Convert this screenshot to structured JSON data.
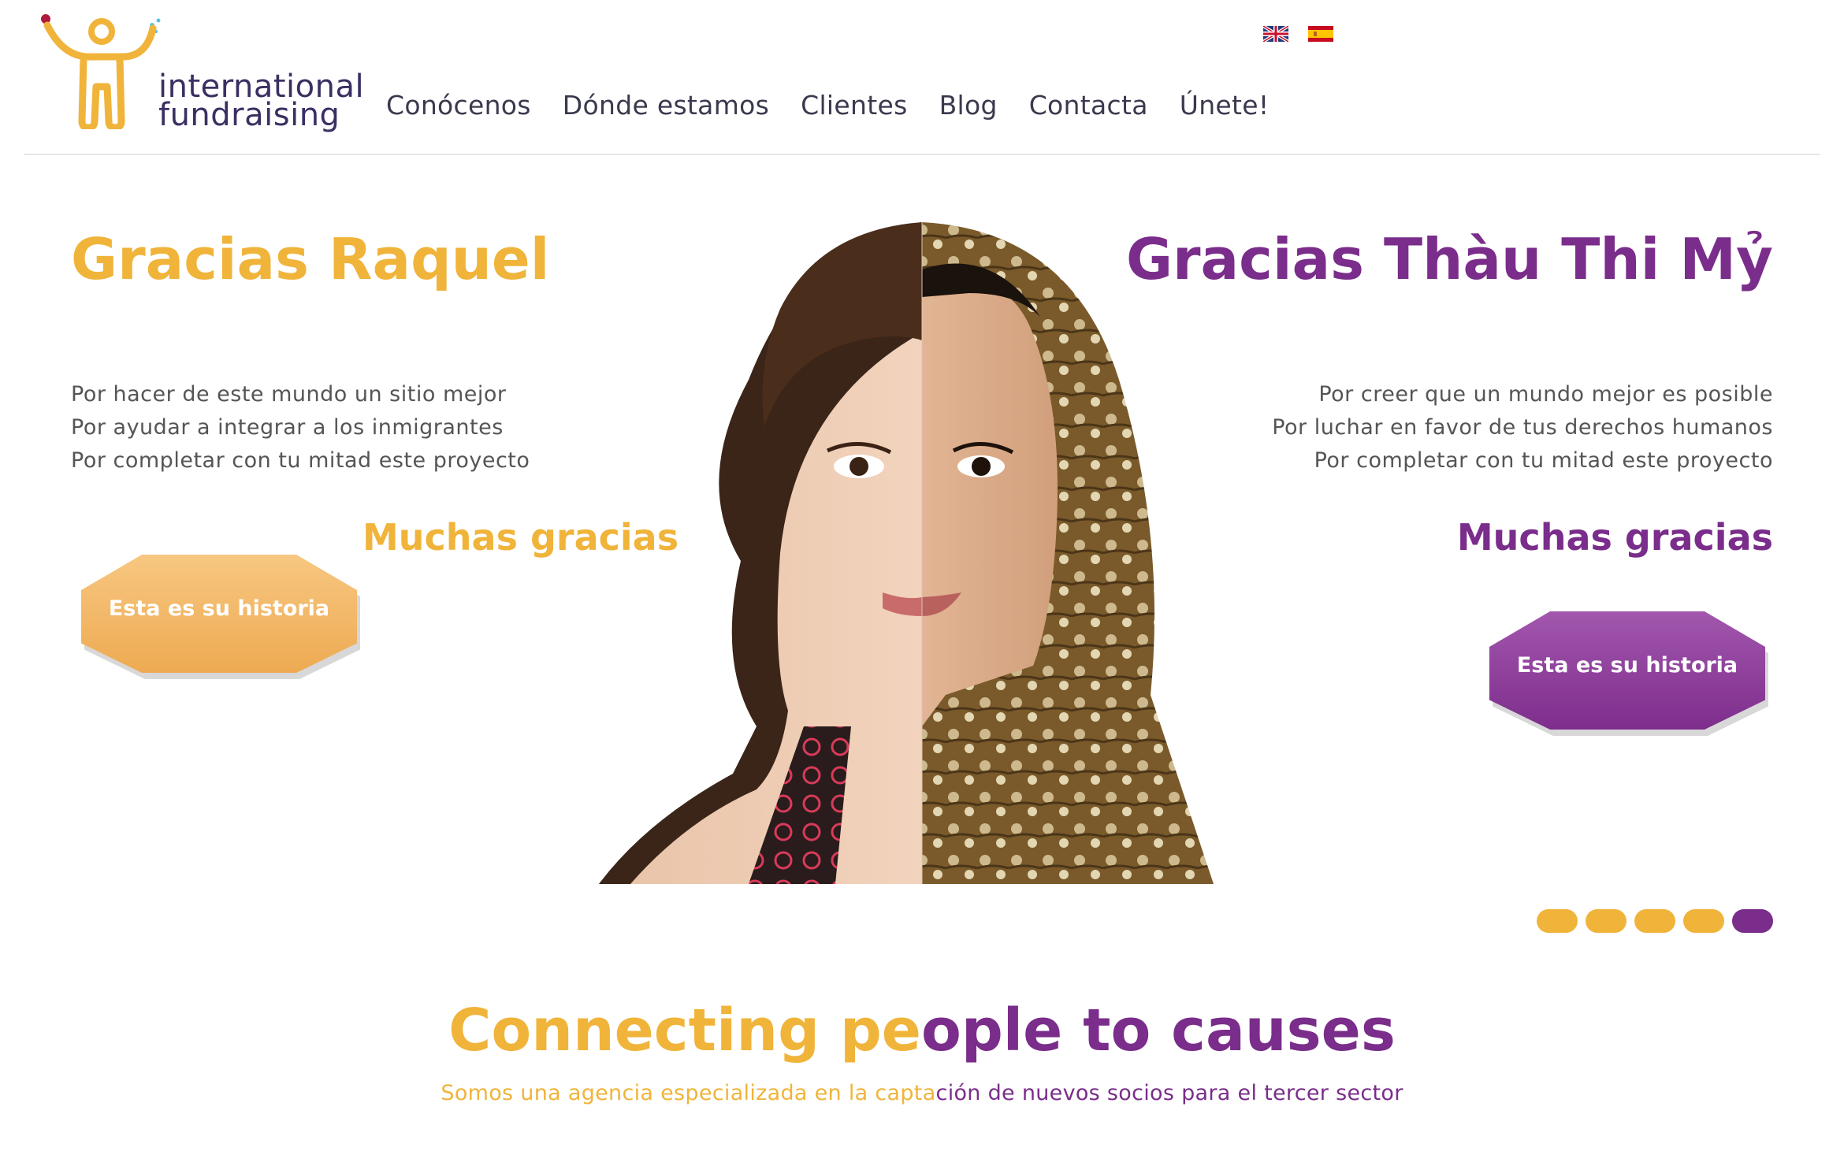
{
  "brand": {
    "line1": "international",
    "line2": "fundraising"
  },
  "nav": [
    "Conócenos",
    "Dónde estamos",
    "Clientes",
    "Blog",
    "Contacta",
    "Únete!"
  ],
  "languages": [
    {
      "code": "en",
      "icon": "uk-flag-icon"
    },
    {
      "code": "es",
      "icon": "spain-flag-icon"
    }
  ],
  "slide": {
    "left": {
      "title": "Gracias Raquel",
      "lines": [
        "Por hacer de este mundo un sitio mejor",
        "Por ayudar a integrar a los inmigrantes",
        "Por completar con tu mitad este proyecto"
      ],
      "thanks": "Muchas gracias",
      "button": "Esta es su historia"
    },
    "right": {
      "title": "Gracias Thàu Thi Mỷ",
      "lines": [
        "Por creer que un mundo mejor es posible",
        "Por luchar en favor de tus derechos humanos",
        "Por completar con tu mitad este proyecto"
      ],
      "thanks": "Muchas gracias",
      "button": "Esta es su historia"
    }
  },
  "slider": {
    "count": 5,
    "active_index": 5
  },
  "tagline": {
    "part1": "Connecting pe",
    "part2": "ople to causes"
  },
  "subline": {
    "part1": "Somos una agencia especializada en la capta",
    "part2": "ción de nuevos socios para el tercer sector"
  },
  "colors": {
    "orange": "#f0b43a",
    "purple": "#7a2d8a",
    "navy": "#3b2f62"
  }
}
